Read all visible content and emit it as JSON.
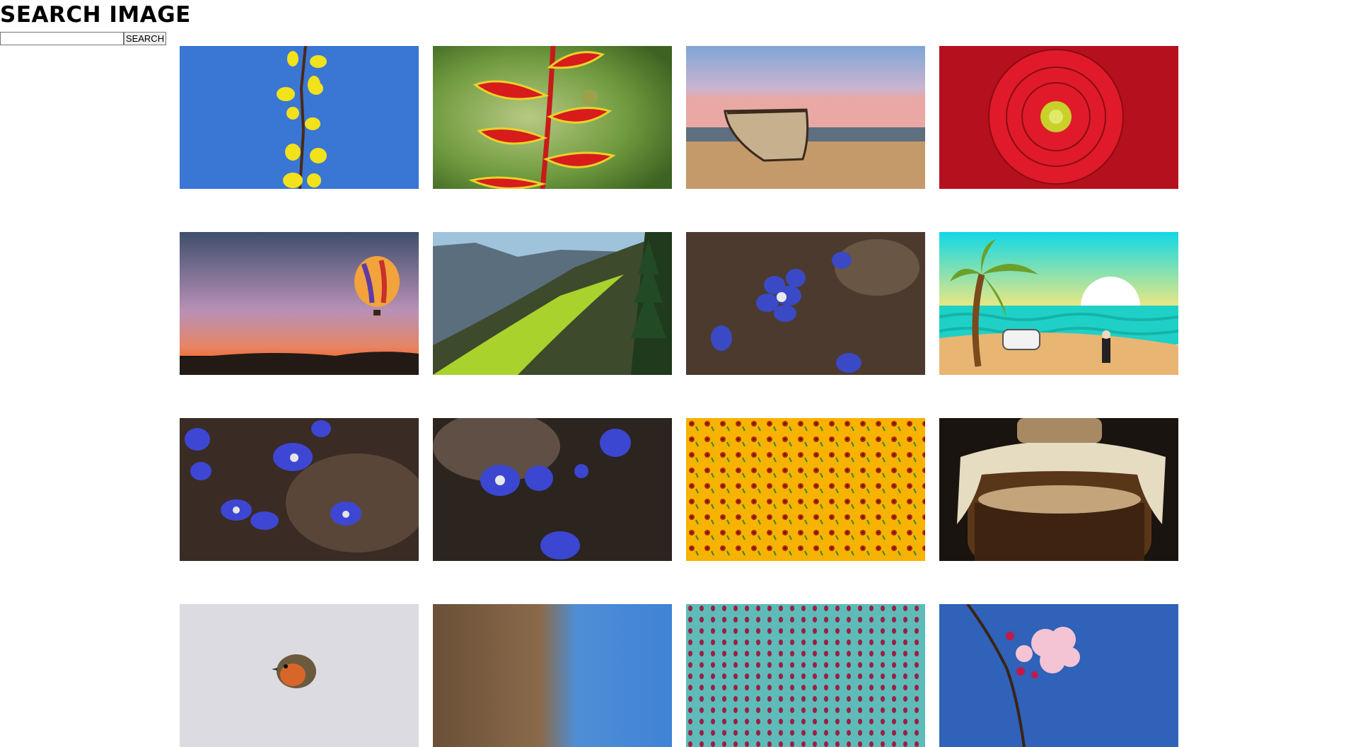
{
  "header": {
    "title": "SEARCH IMAGE"
  },
  "search": {
    "value": "",
    "placeholder": "",
    "button_label": "SEARCH"
  },
  "gallery": {
    "images": [
      {
        "subject": "yellow forsythia branch against blue sky"
      },
      {
        "subject": "red heliconia flower with frog"
      },
      {
        "subject": "wooden boat on beach at dusk"
      },
      {
        "subject": "red dahlia flower close-up"
      },
      {
        "subject": "hot air balloon at sunset"
      },
      {
        "subject": "green mountain slope with fir tree and birds"
      },
      {
        "subject": "blue hepatica flower"
      },
      {
        "subject": "cartoon beach with palm tree, car and man"
      },
      {
        "subject": "blue hepatica flowers cluster"
      },
      {
        "subject": "blue hepatica flowers on dark background"
      },
      {
        "subject": "orange sunflower pattern"
      },
      {
        "subject": "fermenting jar covered with cloth"
      },
      {
        "subject": "robin bird"
      },
      {
        "subject": "blurred landscape with blue sky"
      },
      {
        "subject": "teal pattern with red motifs"
      },
      {
        "subject": "pink cherry blossom against blue sky"
      }
    ]
  }
}
